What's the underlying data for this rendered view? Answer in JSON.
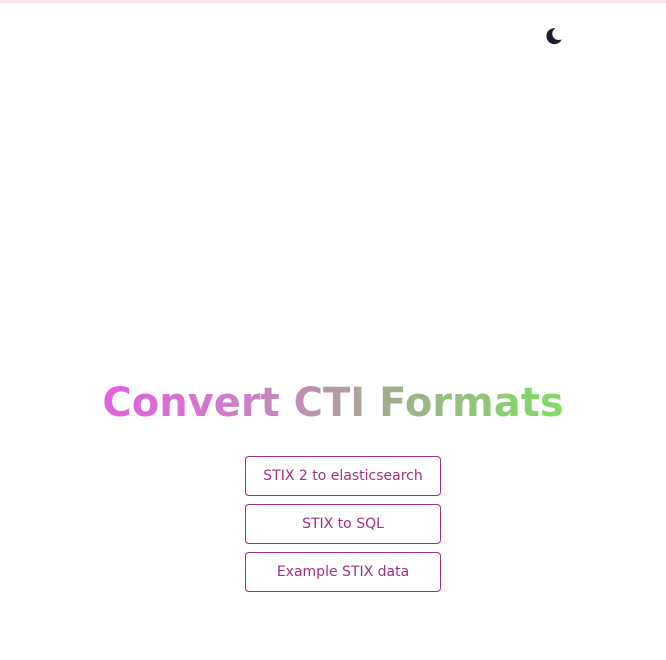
{
  "header": {
    "theme_toggle_icon": "moon-icon"
  },
  "hero": {
    "title": "Convert CTI Formats"
  },
  "nav": {
    "buttons": [
      {
        "label": "STIX 2 to elasticsearch"
      },
      {
        "label": "STIX to SQL"
      },
      {
        "label": "Example STIX data"
      }
    ]
  },
  "colors": {
    "button_accent": "#a0307e",
    "title_gradient_start": "#e35fe0",
    "title_gradient_end": "#7fdd66",
    "moon_icon": "#1f1b2d",
    "top_line": "#fde7ee"
  }
}
